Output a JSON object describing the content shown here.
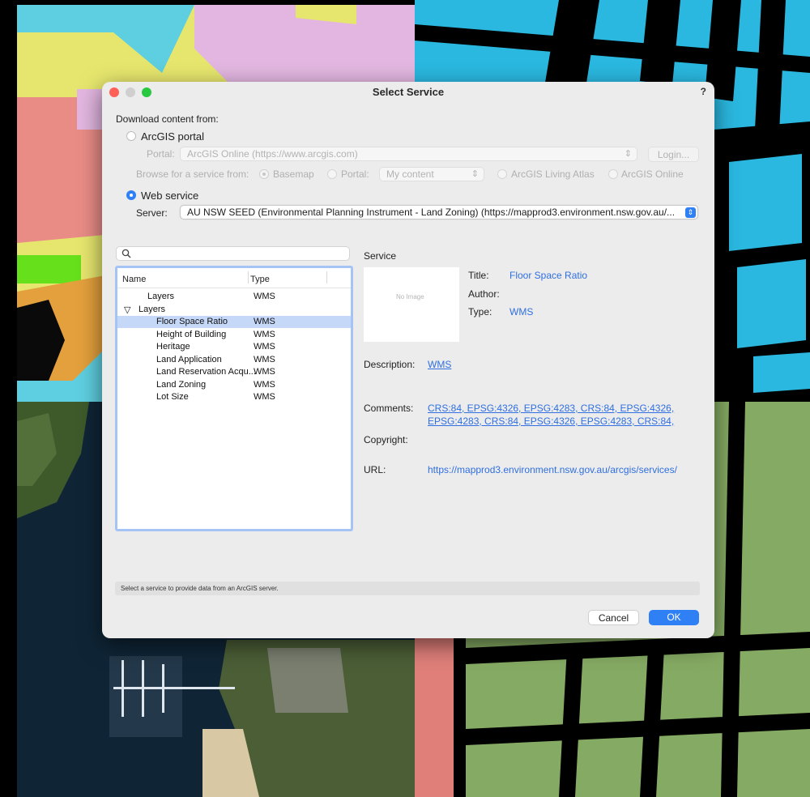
{
  "dialog": {
    "title": "Select Service",
    "help": "?"
  },
  "download": {
    "heading": "Download content from:",
    "arcgis_portal_label": "ArcGIS portal",
    "portal_label": "Portal:",
    "portal_value": "ArcGIS Online   (https://www.arcgis.com)",
    "login_label": "Login...",
    "browse_label": "Browse for a service from:",
    "basemap_label": "Basemap",
    "portal_option_label": "Portal:",
    "my_content_value": "My content",
    "living_atlas_label": "ArcGIS Living Atlas",
    "arcgis_online_label": "ArcGIS Online",
    "web_service_label": "Web service",
    "server_label": "Server:",
    "server_value": "AU NSW SEED (Environmental Planning Instrument - Land Zoning)   (https://mapprod3.environment.nsw.gov.au/..."
  },
  "tree": {
    "col_name": "Name",
    "col_type": "Type",
    "rows": [
      {
        "name": "Layers",
        "type": "WMS",
        "indent": 1,
        "toggle": "",
        "selected": false
      },
      {
        "name": "Layers",
        "type": "",
        "indent": 0,
        "toggle": "▽",
        "selected": false
      },
      {
        "name": "Floor Space Ratio",
        "type": "WMS",
        "indent": 2,
        "toggle": "",
        "selected": true
      },
      {
        "name": "Height of Building",
        "type": "WMS",
        "indent": 2,
        "toggle": "",
        "selected": false
      },
      {
        "name": "Heritage",
        "type": "WMS",
        "indent": 2,
        "toggle": "",
        "selected": false
      },
      {
        "name": "Land Application",
        "type": "WMS",
        "indent": 2,
        "toggle": "",
        "selected": false
      },
      {
        "name": "Land Reservation Acqu...",
        "type": "WMS",
        "indent": 2,
        "toggle": "",
        "selected": false
      },
      {
        "name": "Land Zoning",
        "type": "WMS",
        "indent": 2,
        "toggle": "",
        "selected": false
      },
      {
        "name": "Lot Size",
        "type": "WMS",
        "indent": 2,
        "toggle": "",
        "selected": false
      }
    ]
  },
  "service": {
    "heading": "Service",
    "no_image": "No Image",
    "title_label": "Title:",
    "title_value": "Floor Space Ratio",
    "author_label": "Author:",
    "author_value": "",
    "type_label": "Type:",
    "type_value": "WMS",
    "description_label": "Description:",
    "description_value": "WMS",
    "comments_label": "Comments:",
    "comments_line1": "CRS:84, EPSG:4326, EPSG:4283, CRS:84, EPSG:4326,",
    "comments_line2": "EPSG:4283, CRS:84, EPSG:4326, EPSG:4283, CRS:84,",
    "copyright_label": "Copyright:",
    "url_label": "URL:",
    "url_value": "https://mapprod3.environment.nsw.gov.au/arcgis/services/"
  },
  "status_text": "Select a service to provide data from an ArcGIS server.",
  "buttons": {
    "cancel": "Cancel",
    "ok": "OK"
  },
  "colors": {
    "accent": "#2f7ff5",
    "link": "#2f6fe0",
    "selection": "#c5d8f8"
  }
}
